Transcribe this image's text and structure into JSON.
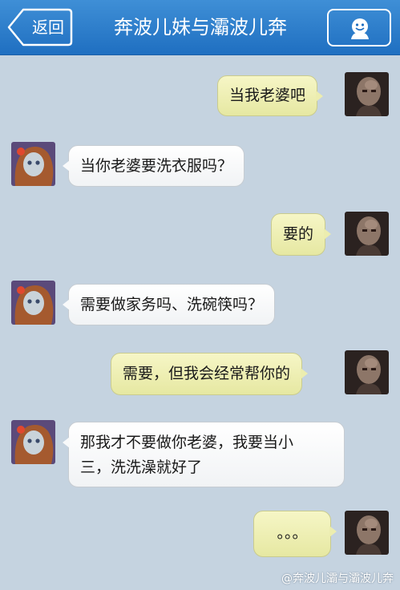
{
  "header": {
    "back_label": "返回",
    "title": "奔波儿妹与灞波儿奔",
    "profile_icon": "person-icon"
  },
  "messages": [
    {
      "sender": "self",
      "text": "当我老婆吧"
    },
    {
      "sender": "other",
      "text": "当你老婆要洗衣服吗？"
    },
    {
      "sender": "self",
      "text": "要的"
    },
    {
      "sender": "other",
      "text": "需要做家务吗、洗碗筷吗？"
    },
    {
      "sender": "self",
      "text": "需要，但我会经常帮你的"
    },
    {
      "sender": "other",
      "lines": [
        "那我才不要做你老婆，我要当小",
        "三，洗洗澡就好了"
      ]
    },
    {
      "sender": "self",
      "text": "。。。"
    }
  ],
  "watermark": "@奔波儿灞与灞波儿奔",
  "colors": {
    "header_blue": "#2a7dcb",
    "background": "#c5d3e0",
    "self_bubble": "#eeefb5",
    "other_bubble": "#ffffff"
  }
}
